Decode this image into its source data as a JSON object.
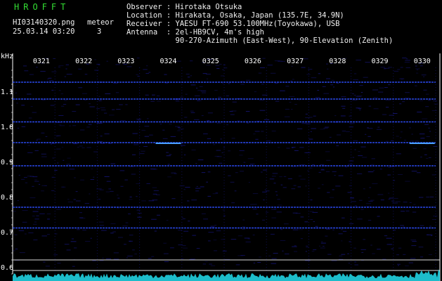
{
  "header": {
    "title": "HROFFT",
    "filename": "HI03140320.png",
    "datetime": "25.03.14 03:20",
    "meteor_label": "meteor",
    "meteor_count": "3",
    "observer": "Observer : Hirotaka Otsuka",
    "location": "Location : Hirakata, Osaka, Japan (135.7E, 34.9N)",
    "receiver": "Receiver : YAESU FT-690 53.100MHz(Toyokawa), USB",
    "antenna": "Antenna  : 2el-HB9CV, 4m's high",
    "antenna2": "           90-270-Azimuth (East-West), 90-Elevation (Zenith)"
  },
  "colors": {
    "title": "#33dd33",
    "text": "#f0f0f0",
    "axis": "#ffffff",
    "signal_line": "#2f4fff",
    "noise": "#121266",
    "spectrum": "#20d0e0"
  },
  "chart_data": {
    "type": "heatmap",
    "ylabel": "kHz",
    "ylim": [
      0.58,
      1.17
    ],
    "yticks": [
      "1.1",
      "1.0",
      "0.9",
      "0.8",
      "0.7",
      "0.6"
    ],
    "xticks": [
      "0321",
      "0322",
      "0323",
      "0324",
      "0325",
      "0326",
      "0327",
      "0328",
      "0329",
      "0330"
    ],
    "signal_lines_khz": [
      1.126,
      1.078,
      1.013,
      0.954,
      0.888,
      0.77,
      0.711
    ],
    "meteor_echoes": [
      {
        "minute": "0324",
        "khz": 0.952
      },
      {
        "minute": "0330",
        "khz": 0.952
      }
    ]
  }
}
